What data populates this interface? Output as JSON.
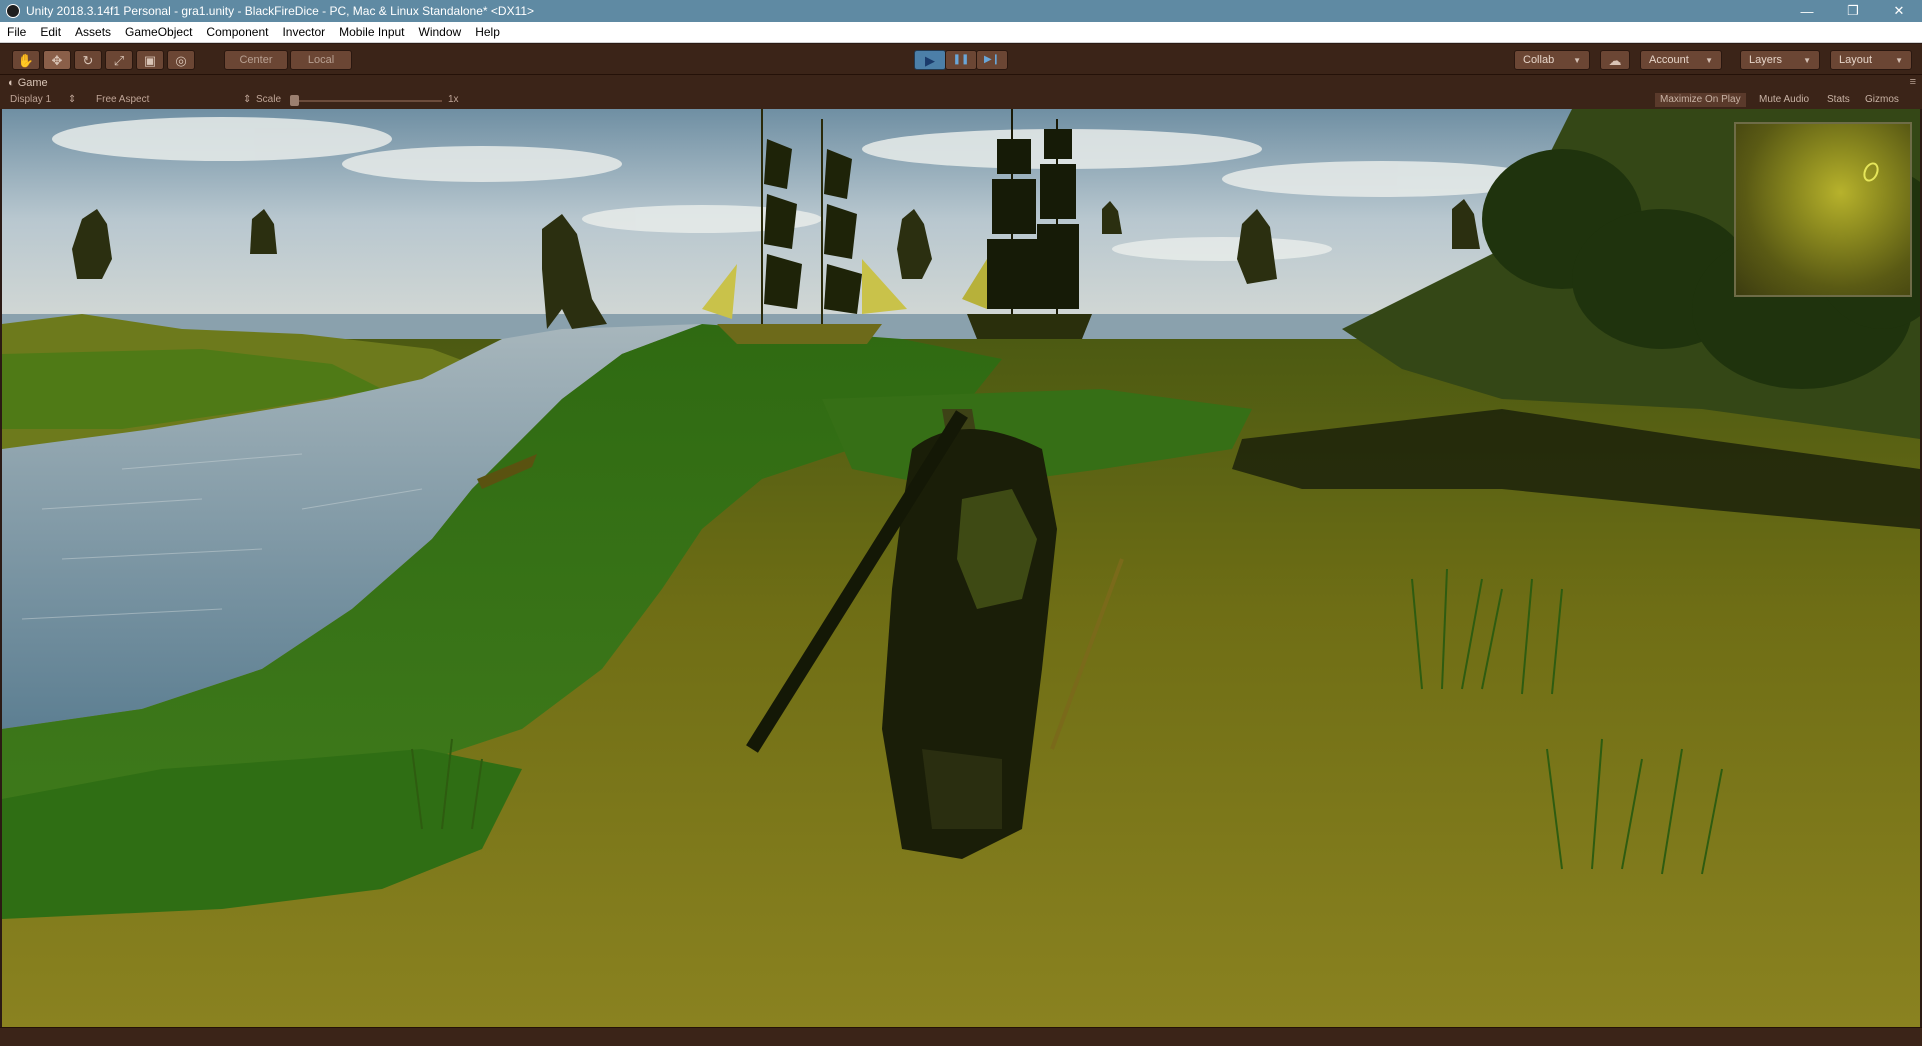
{
  "window": {
    "title": "Unity 2018.3.14f1 Personal - gra1.unity - BlackFireDice - PC, Mac & Linux Standalone* <DX11>",
    "controls": {
      "minimize": "—",
      "restore": "❐",
      "close": "✕"
    }
  },
  "menu": {
    "items": [
      "File",
      "Edit",
      "Assets",
      "GameObject",
      "Component",
      "Invector",
      "Mobile Input",
      "Window",
      "Help"
    ]
  },
  "toolbar": {
    "tools": {
      "hand": "✋",
      "move": "✥",
      "rotate": "↻",
      "scale": "⤢",
      "rect": "▣",
      "transform": "◎"
    },
    "pivot_label": "Center",
    "rotation_label": "Local",
    "play": "▶",
    "pause": "❚❚",
    "step": "▶❙",
    "collab_label": "Collab",
    "cloud": "☁",
    "account_label": "Account",
    "layers_label": "Layers",
    "layout_label": "Layout"
  },
  "game_view": {
    "tab_label": "Game",
    "tab_menu": "≡",
    "display_label": "Display 1",
    "aspect_label": "Free Aspect",
    "scale_label": "Scale",
    "scale_value": "1x",
    "toggles": [
      "Maximize On Play",
      "Mute Audio",
      "Stats",
      "Gizmos"
    ],
    "maximize_on_play_enabled": true
  },
  "colors": {
    "titlebar": "#5f8aa3",
    "editor_dark": "#3b2418",
    "play_button": "#4c7fa8",
    "sky": "#9fb9c8",
    "water": "#6f8fa0",
    "grass": "#2f6f16",
    "sand": "#7f7a16"
  }
}
